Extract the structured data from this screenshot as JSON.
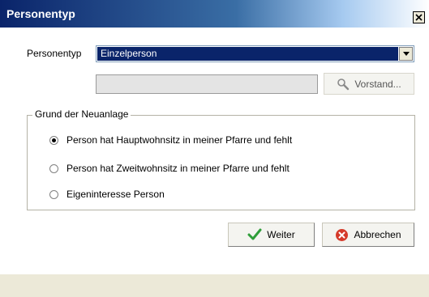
{
  "window": {
    "title": "Personentyp",
    "close_label": "×"
  },
  "form": {
    "personentyp_label": "Personentyp",
    "personentyp_value": "Einzelperson",
    "lookup_value": "",
    "vorstand_button": "Vorstand..."
  },
  "group": {
    "title": "Grund der Neuanlage",
    "options": [
      {
        "label": "Person hat Hauptwohnsitz in meiner Pfarre und fehlt",
        "checked": true
      },
      {
        "label": "Person hat Zweitwohnsitz in meiner Pfarre und fehlt",
        "checked": false
      },
      {
        "label": "Eigeninteresse Person",
        "checked": false
      }
    ]
  },
  "actions": {
    "weiter": "Weiter",
    "abbrechen": "Abbrechen"
  },
  "colors": {
    "accent": "#0a246a",
    "ok": "#2f9e3a",
    "cancel": "#d53a2a"
  }
}
